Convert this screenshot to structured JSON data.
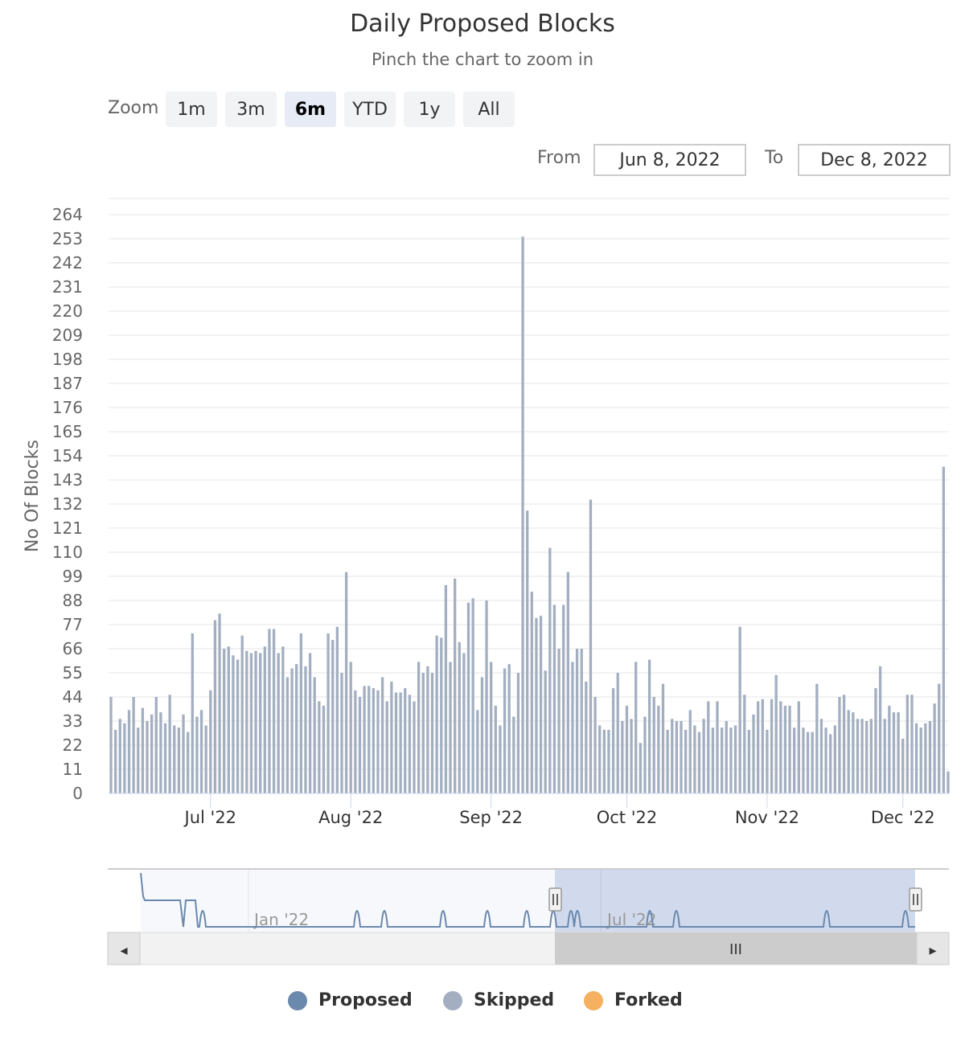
{
  "chart_data": {
    "type": "bar",
    "title": "Daily Proposed Blocks",
    "subtitle": "Pinch the chart to zoom in",
    "ylabel": "No Of Blocks",
    "ylim": [
      0,
      264
    ],
    "yticks": [
      "0",
      "11",
      "22",
      "33",
      "44",
      "55",
      "66",
      "77",
      "88",
      "99",
      "110",
      "121",
      "132",
      "143",
      "154",
      "165",
      "176",
      "187",
      "198",
      "209",
      "220",
      "231",
      "242",
      "253",
      "264"
    ],
    "xticks": [
      {
        "label": "Jul '22",
        "day": 22
      },
      {
        "label": "Aug '22",
        "day": 53
      },
      {
        "label": "Sep '22",
        "day": 84
      },
      {
        "label": "Oct '22",
        "day": 114
      },
      {
        "label": "Nov '22",
        "day": 145
      },
      {
        "label": "Dec '22",
        "day": 175
      }
    ],
    "start_date": "Jun 8, 2022",
    "series": [
      {
        "name": "Proposed",
        "color": "#6b89ad",
        "values": []
      },
      {
        "name": "Skipped",
        "color": "#a3afc1",
        "values": [
          44,
          29,
          34,
          32,
          38,
          44,
          30,
          39,
          33,
          36,
          44,
          37,
          32,
          45,
          31,
          30,
          36,
          28,
          73,
          35,
          38,
          31,
          47,
          79,
          82,
          66,
          67,
          63,
          61,
          72,
          65,
          64,
          65,
          64,
          67,
          75,
          75,
          64,
          67,
          53,
          57,
          59,
          73,
          58,
          64,
          53,
          42,
          40,
          73,
          70,
          76,
          55,
          101,
          60,
          47,
          44,
          49,
          49,
          48,
          47,
          53,
          42,
          51,
          46,
          46,
          48,
          45,
          42,
          60,
          55,
          58,
          55,
          72,
          71,
          95,
          60,
          98,
          69,
          64,
          87,
          89,
          38,
          53,
          88,
          60,
          40,
          31,
          57,
          59,
          35,
          55,
          254,
          129,
          92,
          80,
          81,
          56,
          112,
          86,
          66,
          86,
          101,
          60,
          66,
          66,
          51,
          134,
          44,
          31,
          29,
          29,
          48,
          55,
          33,
          40,
          34,
          60,
          23,
          35,
          61,
          44,
          40,
          50,
          29,
          34,
          33,
          33,
          29,
          38,
          31,
          28,
          34,
          42,
          30,
          42,
          30,
          33,
          30,
          31,
          76,
          45,
          29,
          36,
          42,
          43,
          29,
          43,
          54,
          42,
          40,
          40,
          30,
          42,
          30,
          28,
          28,
          50,
          34,
          30,
          27,
          31,
          44,
          45,
          38,
          37,
          34,
          34,
          33,
          34,
          48,
          58,
          34,
          40,
          37,
          37,
          25,
          45,
          45,
          32,
          30,
          32,
          33,
          41,
          50,
          149,
          10
        ]
      },
      {
        "name": "Forked",
        "color": "#f5b060",
        "values": []
      }
    ],
    "navigator": {
      "labels": [
        {
          "label": "Jan '22"
        },
        {
          "label": "Jul '22"
        }
      ]
    }
  },
  "zoom": {
    "label": "Zoom",
    "buttons": [
      "1m",
      "3m",
      "6m",
      "YTD",
      "1y",
      "All"
    ],
    "active": "6m"
  },
  "range": {
    "from_label": "From",
    "from_value": "Jun 8, 2022",
    "to_label": "To",
    "to_value": "Dec 8, 2022"
  },
  "scrollbar": {
    "left_arrow": "◂",
    "right_arrow": "▸",
    "grip": "III"
  },
  "colors": {
    "grid": "#e6e6e6",
    "axis_text": "#666666",
    "bar": "#a3afc1",
    "navigator_fill": "rgba(102,133,194,0.3)",
    "navigator_line": "#6b89ad"
  }
}
